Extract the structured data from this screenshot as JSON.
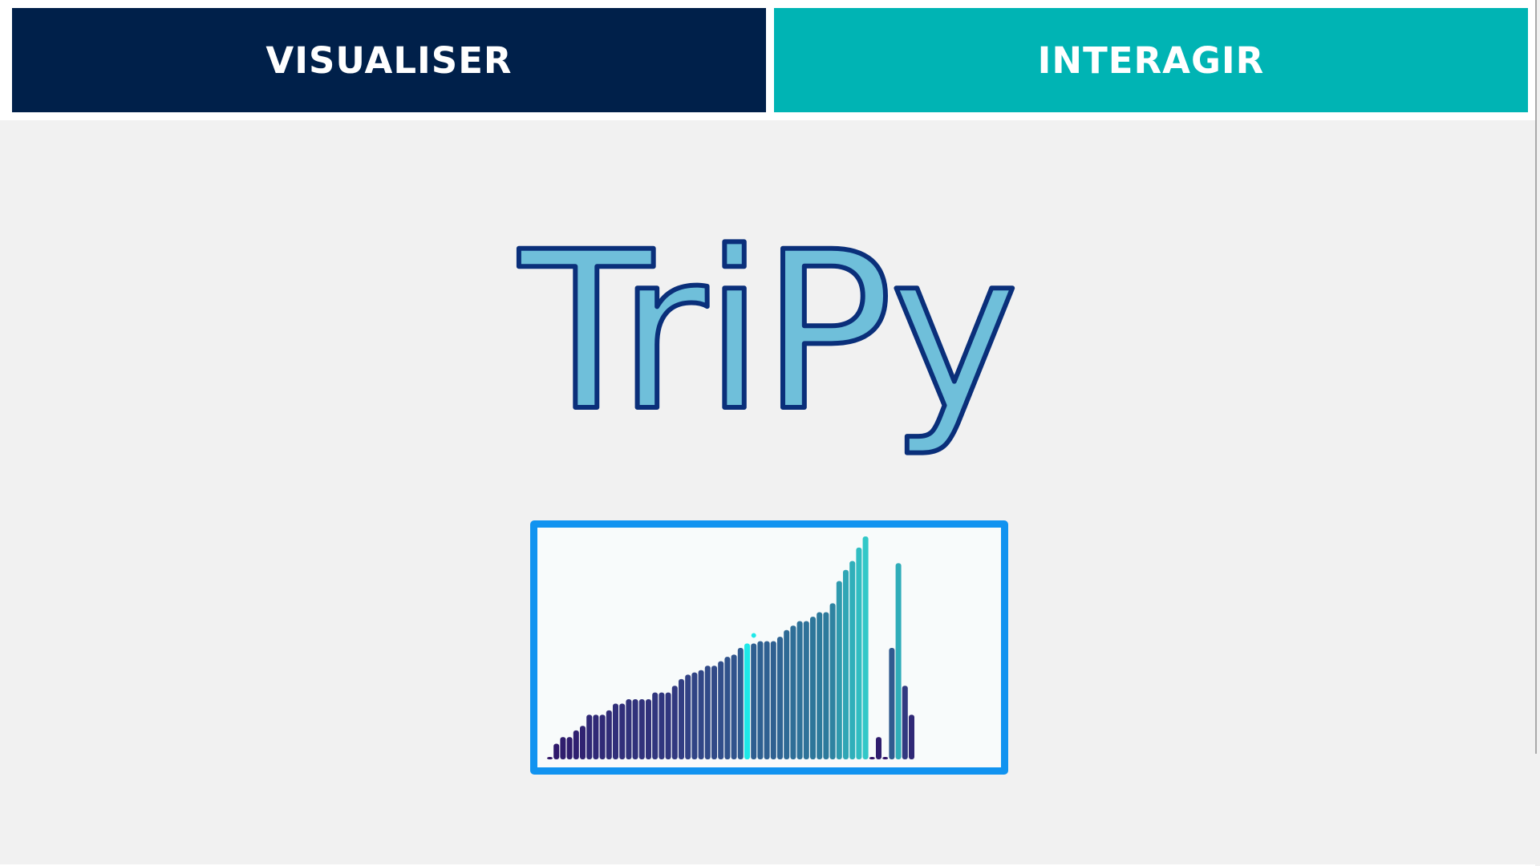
{
  "nav": {
    "visualiser_label": "VISUALISER",
    "interagir_label": "INTERAGIR"
  },
  "logo": {
    "text": "TriPy",
    "fill_color": "#6fbfda",
    "stroke_color": "#0a2f7a"
  },
  "colors": {
    "visualiser_bg": "#00204a",
    "interagir_bg": "#00b4b4",
    "page_bg": "#f1f1f1",
    "preview_border": "#1193f0",
    "highlight_bar": "#1ee8e8"
  },
  "chart_data": {
    "type": "bar",
    "description_of_values": "sorting animation thumbnail, bar heights as fraction of max",
    "values": [
      0.01,
      0.07,
      0.1,
      0.1,
      0.13,
      0.15,
      0.2,
      0.2,
      0.2,
      0.22,
      0.25,
      0.25,
      0.27,
      0.27,
      0.27,
      0.27,
      0.3,
      0.3,
      0.3,
      0.33,
      0.36,
      0.38,
      0.39,
      0.4,
      0.42,
      0.42,
      0.44,
      0.46,
      0.47,
      0.5,
      0.52,
      0.52,
      0.53,
      0.53,
      0.53,
      0.55,
      0.58,
      0.6,
      0.62,
      0.62,
      0.64,
      0.66,
      0.66,
      0.7,
      0.8,
      0.85,
      0.89,
      0.95,
      1.0,
      0.0,
      0.1,
      0.0,
      0.5,
      0.88,
      0.33,
      0.2
    ],
    "highlighted_index": 30,
    "marker_dot_index": 31
  }
}
